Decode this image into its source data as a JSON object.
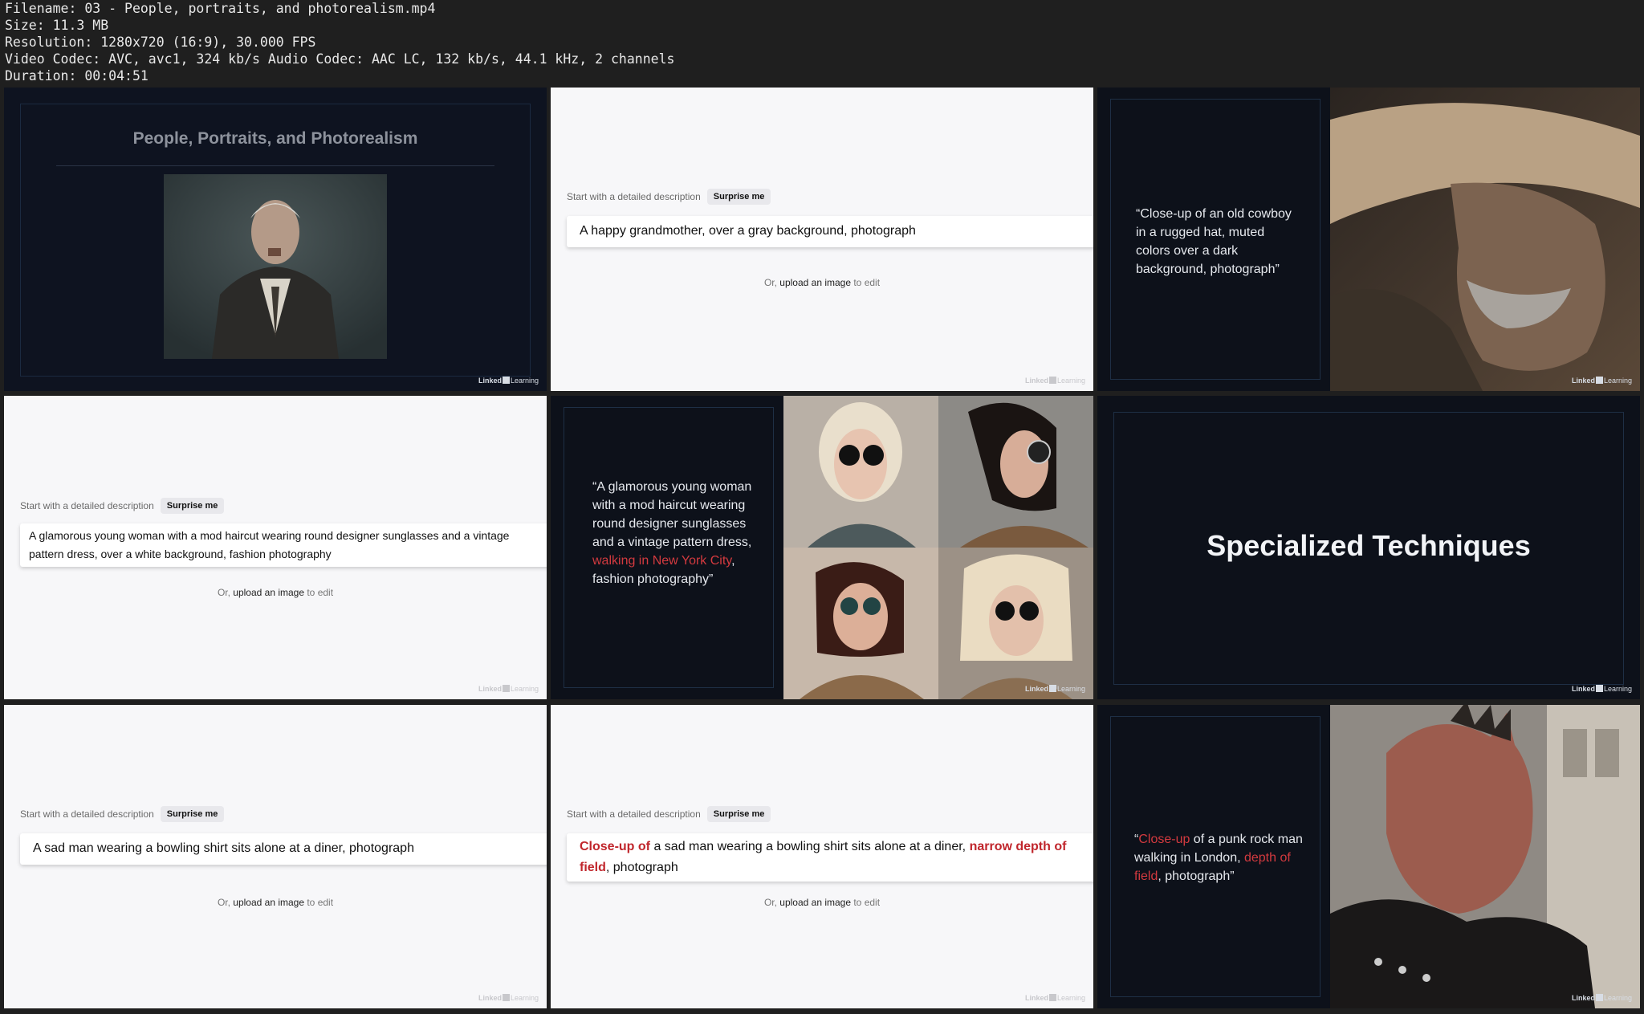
{
  "header": {
    "filename": "Filename: 03 - People, portraits, and photorealism.mp4",
    "size": "Size: 11.3 MB",
    "resolution": "Resolution: 1280x720 (16:9), 30.000 FPS",
    "codec": "Video Codec: AVC, avc1, 324 kb/s Audio Codec: AAC LC, 132 kb/s, 44.1 kHz, 2 channels",
    "duration": "Duration: 00:04:51"
  },
  "watermark": {
    "linked": "Linked",
    "learning": "Learning"
  },
  "common": {
    "start_label": "Start with a detailed description",
    "surprise": "Surprise me",
    "upload_or": "Or, ",
    "upload_link": "upload an image",
    "upload_tail": " to edit"
  },
  "t1": {
    "title": "People, Portraits, and Photorealism"
  },
  "t2": {
    "prompt": "A happy grandmother, over a gray background, photograph"
  },
  "t3": {
    "quote": "“Close-up of an old cowboy in a rugged hat, muted colors over a dark background, photograph”"
  },
  "t4": {
    "prompt": "A glamorous young woman with a mod haircut wearing round designer sunglasses and a vintage pattern dress, over a white background, fashion photography"
  },
  "t5": {
    "q1": "“A glamorous young woman with a mod haircut wearing round designer sunglasses and a vintage pattern dress, ",
    "q2": "walking in New York City",
    "q3": ", fashion photography”"
  },
  "t6": {
    "title": "Specialized Techniques"
  },
  "t7": {
    "prompt": "A sad man wearing a bowling shirt sits alone at a diner, photograph"
  },
  "t8": {
    "p1": "Close-up of",
    "p2": " a sad man wearing a bowling shirt sits alone at a diner, ",
    "p3": "narrow depth of field",
    "p4": ", photograph"
  },
  "t9": {
    "q1": "“",
    "q2": "Close-up",
    "q3": " of a punk rock man walking in London, ",
    "q4": "depth of field",
    "q5": ", photograph”"
  }
}
